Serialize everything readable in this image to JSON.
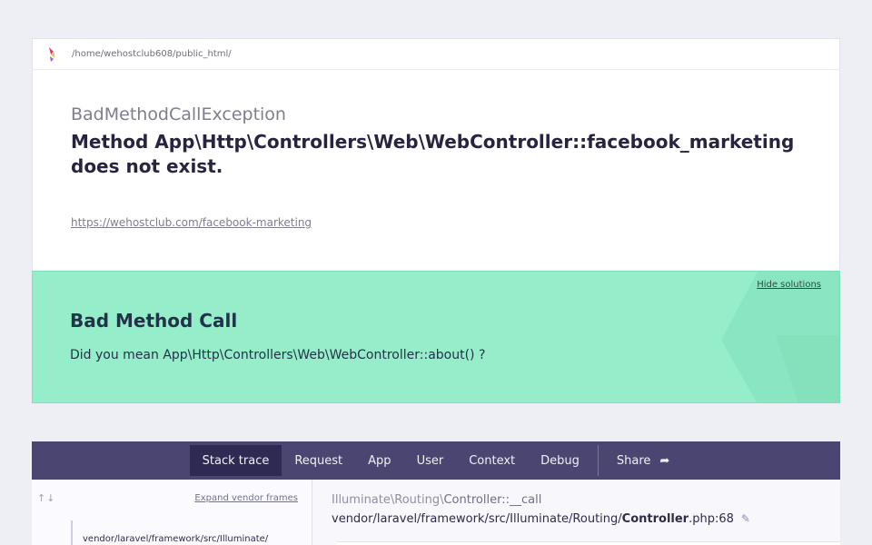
{
  "header": {
    "path": "/home/wehostclub608/public_html/"
  },
  "exception": {
    "class": "BadMethodCallException",
    "message": "Method App\\Http\\Controllers\\Web\\WebController::facebook_marketing does not exist.",
    "url": "https://wehostclub.com/facebook-marketing"
  },
  "solution": {
    "hide_label": "Hide solutions",
    "title": "Bad Method Call",
    "text": "Did you mean App\\Http\\Controllers\\Web\\WebController::about() ?"
  },
  "tabs": [
    {
      "label": "Stack trace",
      "active": true
    },
    {
      "label": "Request"
    },
    {
      "label": "App"
    },
    {
      "label": "User"
    },
    {
      "label": "Context"
    },
    {
      "label": "Debug"
    }
  ],
  "share_label": "Share",
  "frames": {
    "expand_label": "Expand vendor frames",
    "first_file": "vendor/laravel/framework/src/Illuminate/"
  },
  "detail": {
    "namespace": "Illuminate\\Routing\\",
    "class_method": "Controller::__call",
    "file_dir": "vendor/laravel/framework/src/Illuminate/Routing/",
    "file_name": "Controller",
    "file_ext_line": ".php:68"
  },
  "colors": {
    "solution_bg": "#95eec9",
    "nav_bg": "#4b4572",
    "nav_active": "#2f2a53"
  }
}
